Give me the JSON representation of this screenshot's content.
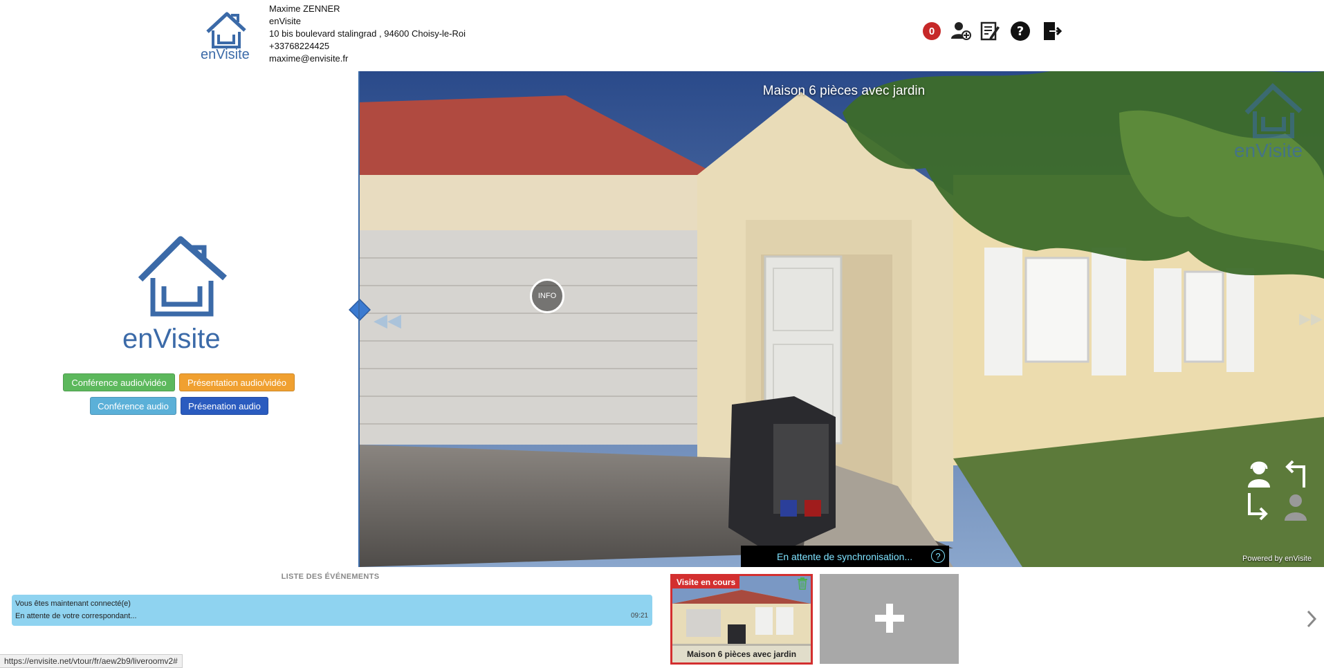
{
  "header": {
    "brand_name": "enVisite",
    "user_name": "Maxime ZENNER",
    "company": "enVisite",
    "address": "10 bis boulevard stalingrad , 94600 Choisy-le-Roi",
    "phone": "+33768224425",
    "email": "maxime@envisite.fr",
    "notification_count": "0",
    "icons": [
      "add-user-icon",
      "notes-icon",
      "help-icon",
      "logout-icon"
    ]
  },
  "left_panel": {
    "brand_name": "enVisite",
    "buttons": {
      "conf_av": "Conférence audio/vidéo",
      "pres_av": "Présentation audio/vidéo",
      "conf_audio": "Conférence audio",
      "pres_audio": "Présenation audio"
    }
  },
  "viewer": {
    "title": "Maison 6 pièces avec jardin",
    "watermark": "enVisite",
    "info_hotspot": "INFO",
    "sync_status": "En attente de synchronisation...",
    "powered_by": "Powered by enVisite"
  },
  "events": {
    "title": "LISTE DES ÉVÉNEMENTS",
    "line1": "Vous êtes maintenant connecté(e)",
    "line2": "En attente de votre correspondant...",
    "time": "09:21"
  },
  "visits": {
    "current_badge": "Visite en cours",
    "current_name": "Maison 6 pièces avec jardin"
  },
  "status_bar": {
    "url": "https://envisite.net/vtour/fr/aew2b9/liveroomv2#"
  },
  "colors": {
    "brand_blue": "#3b6aa8",
    "btn_green": "#5cb85c",
    "btn_orange": "#f0a030",
    "btn_lightblue": "#5bb0d8",
    "btn_darkblue": "#2a5bbf",
    "events_bg": "#8fd3f0",
    "current_border": "#d32f2f"
  }
}
